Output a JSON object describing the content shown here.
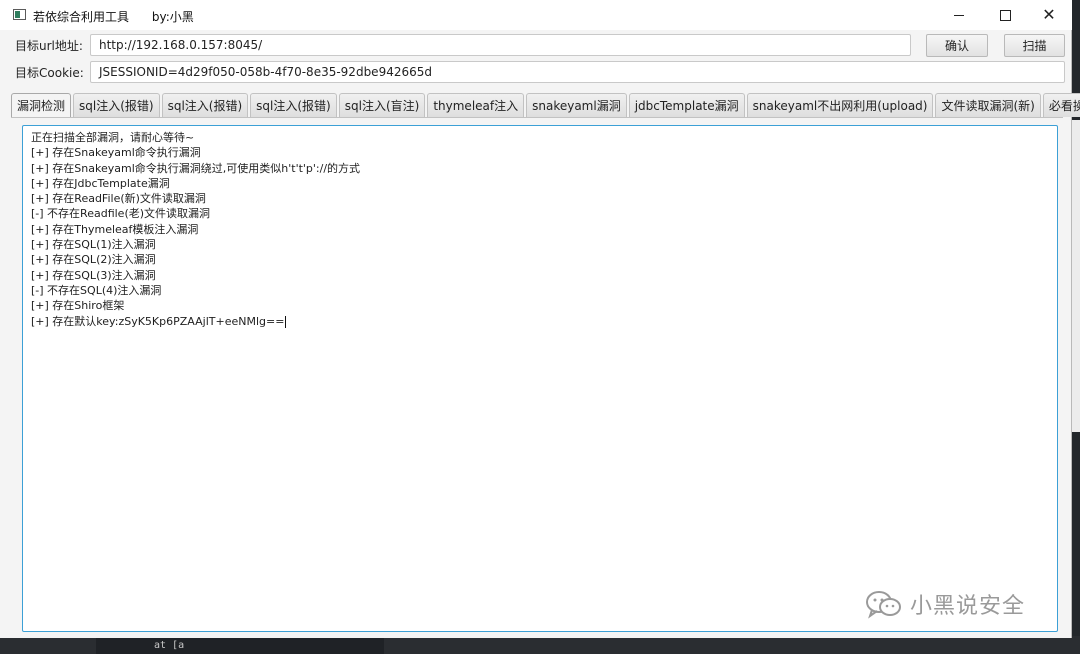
{
  "window": {
    "title": "若依综合利用工具",
    "author": "by:小黑"
  },
  "form": {
    "url_label": "目标url地址:",
    "url_value": "http://192.168.0.157:8045/",
    "cookie_label": "目标Cookie:",
    "cookie_value": "JSESSIONID=4d29f050-058b-4f70-8e35-92dbe942665d",
    "confirm_label": "确认",
    "scan_label": "扫描"
  },
  "tabs": [
    {
      "label": "漏洞检测",
      "active": true
    },
    {
      "label": "sql注入(报错)"
    },
    {
      "label": "sql注入(报错)"
    },
    {
      "label": "sql注入(报错)"
    },
    {
      "label": "sql注入(盲注)"
    },
    {
      "label": "thymeleaf注入"
    },
    {
      "label": "snakeyaml漏洞"
    },
    {
      "label": "jdbcTemplate漏洞"
    },
    {
      "label": "snakeyaml不出网利用(upload)"
    },
    {
      "label": "文件读取漏洞(新)"
    },
    {
      "label": "必看操作说明"
    }
  ],
  "output": {
    "lines": [
      "正在扫描全部漏洞，请耐心等待~",
      "[+] 存在Snakeyaml命令执行漏洞",
      "[+] 存在Snakeyaml命令执行漏洞绕过,可使用类似h't't'p'://的方式",
      "[+] 存在JdbcTemplate漏洞",
      "[+] 存在ReadFile(新)文件读取漏洞",
      "[-] 不存在Readfile(老)文件读取漏洞",
      "[+] 存在Thymeleaf模板注入漏洞",
      "[+] 存在SQL(1)注入漏洞",
      "[+] 存在SQL(2)注入漏洞",
      "[+] 存在SQL(3)注入漏洞",
      "[-] 不存在SQL(4)注入漏洞",
      "[+] 存在Shiro框架",
      "[+] 存在默认key:zSyK5Kp6PZAAjlT+eeNMlg=="
    ]
  },
  "watermark": {
    "text": "小黑说安全",
    "icon": "wechat-icon"
  },
  "background": {
    "terminal_snippet": "at [a"
  },
  "colors": {
    "focus_border": "#3ca0d6",
    "window_bg": "#f4f4f4"
  }
}
